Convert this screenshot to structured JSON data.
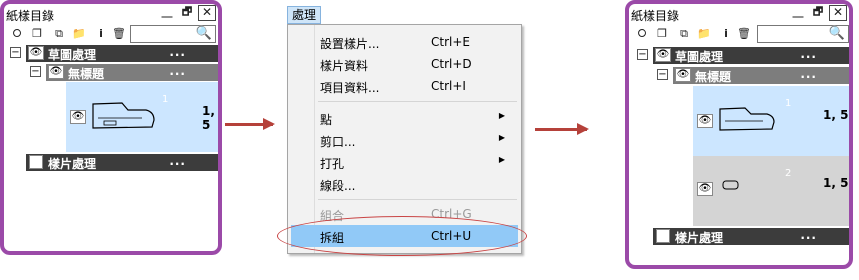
{
  "panel_before": {
    "title": "紙樣目錄",
    "window_buttons": [
      "__",
      "🗗",
      "✕"
    ],
    "toolbar_icons": [
      "new-piece-icon",
      "copy-icon",
      "duplicate-icon",
      "folder-icon",
      "info-icon",
      "trash-icon"
    ],
    "toolbar_glyphs": [
      "⭘",
      "❐",
      "⧉",
      "📁",
      "i",
      "🗑"
    ],
    "search_glyph": "🔍",
    "rows": [
      {
        "label": "草圖處理",
        "dots": "..."
      },
      {
        "label": "無標題",
        "dots": "..."
      }
    ],
    "items": [
      {
        "index": "1",
        "value": "1, 5"
      }
    ],
    "footer_row": {
      "label": "樣片處理",
      "dots": "..."
    }
  },
  "menu": {
    "title": "處理",
    "items": [
      {
        "label": "設置樣片...",
        "shortcut": "Ctrl+E"
      },
      {
        "label": "樣片資料",
        "shortcut": "Ctrl+D"
      },
      {
        "label": "項目資料...",
        "shortcut": "Ctrl+I"
      },
      {
        "label": "點",
        "shortcut": "",
        "submenu": "▶"
      },
      {
        "label": "剪口...",
        "shortcut": "",
        "submenu": "▶"
      },
      {
        "label": "打孔",
        "shortcut": "",
        "submenu": "▶"
      },
      {
        "label": "線段...",
        "shortcut": ""
      },
      {
        "label": "組合",
        "shortcut": "Ctrl+G"
      },
      {
        "label": "拆組",
        "shortcut": "Ctrl+U"
      }
    ]
  },
  "panel_after": {
    "title": "紙樣目錄",
    "window_buttons": [
      "__",
      "🗗",
      "✕"
    ],
    "toolbar_glyphs": [
      "⭘",
      "❐",
      "⧉",
      "📁",
      "i",
      "🗑"
    ],
    "search_glyph": "🔍",
    "rows": [
      {
        "label": "草圖處理",
        "dots": "..."
      },
      {
        "label": "無標題",
        "dots": "..."
      }
    ],
    "items": [
      {
        "index": "1",
        "value": "1, 5"
      },
      {
        "index": "2",
        "value": "1, 5"
      }
    ],
    "footer_row": {
      "label": "樣片處理",
      "dots": "..."
    }
  },
  "colors": {
    "panel_border": "#9b4aa8",
    "row_dark": "#3c3c3c",
    "row_mid": "#7d7d7d",
    "selected_bg": "#cce6ff",
    "arrow": "#b5413a",
    "menu_highlight": "#91c9f7",
    "ring": "#c94545"
  }
}
